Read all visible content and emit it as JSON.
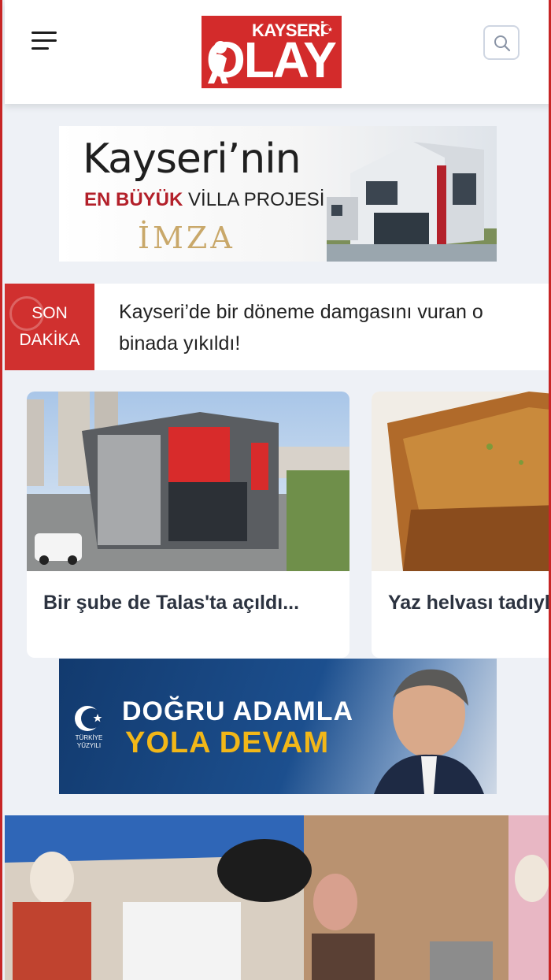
{
  "header": {
    "menu_icon": "hamburger-menu-icon",
    "logo": {
      "top": "KAYSERİ",
      "main": "OLAY"
    },
    "search_icon": "search-icon"
  },
  "ad_top": {
    "headline": "Kayseri’nin",
    "sub_bold": "EN BÜYÜK",
    "sub_rest": "VİLLA PROJESİ",
    "brand": "İMZA"
  },
  "breaking": {
    "tag_line1": "SON",
    "tag_line2": "DAKİKA",
    "headline": "Kayseri’de bir döneme damgasını vuran o binada yıkıldı!"
  },
  "cards": [
    {
      "title": "Bir şube de Talas'ta açıldı..."
    },
    {
      "title": "Yaz helvası tadıyla eşsiz lezzeti"
    }
  ],
  "ad_mid": {
    "emblem_text": "TÜRKİYE YÜZYILI",
    "line1": "DOĞRU ADAMLA",
    "line2": "YOLA DEVAM"
  },
  "colors": {
    "brand_red": "#d32b2b",
    "breaking_red": "#d0302f",
    "page_bg": "#eef1f6",
    "ad_blue": "#1c4f8e",
    "ad_yellow": "#f2b718"
  }
}
